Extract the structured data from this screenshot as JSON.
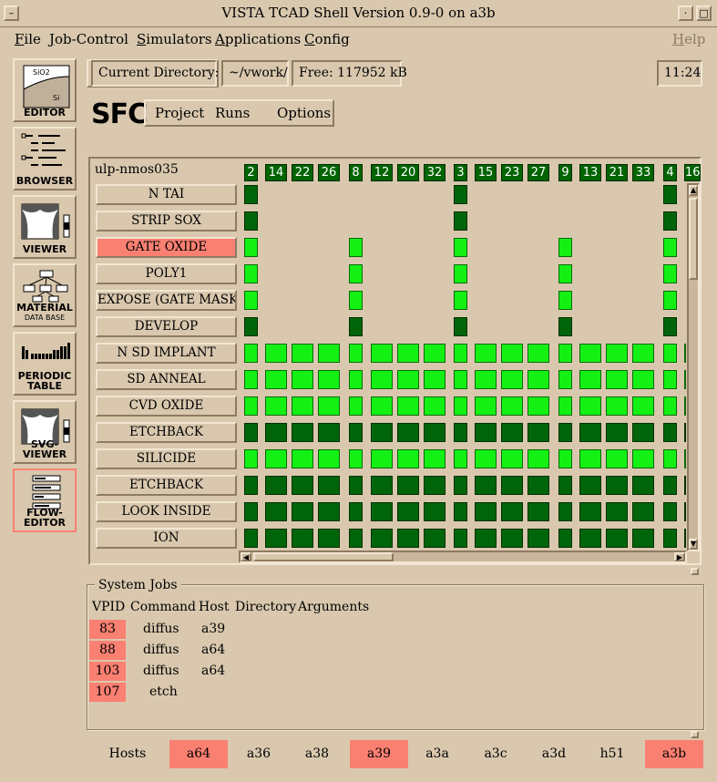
{
  "window": {
    "title": "VISTA TCAD Shell Version 0.9-0 on a3b"
  },
  "menubar": {
    "items": [
      {
        "label": "File",
        "u": "F",
        "rest": "ile"
      },
      {
        "label": "Job-Control",
        "u": "J",
        "rest": "ob-Control"
      },
      {
        "label": "Simulators",
        "u": "S",
        "rest": "imulators"
      },
      {
        "label": "Applications",
        "u": "A",
        "rest": "pplications"
      },
      {
        "label": "Config",
        "u": "C",
        "rest": "onfig"
      }
    ],
    "help": {
      "u": "H",
      "rest": "elp"
    }
  },
  "tools": [
    {
      "label": "EDITOR",
      "icon": "editor-icon"
    },
    {
      "label": "BROWSER",
      "icon": "browser-icon"
    },
    {
      "label": "VIEWER",
      "icon": "viewer-icon"
    },
    {
      "label": "MATERIAL",
      "sub": "DATA BASE",
      "icon": "material-icon"
    },
    {
      "label": "PERIODIC",
      "sub": "TABLE",
      "icon": "periodic-table-icon"
    },
    {
      "label": "SVG-VIEWER",
      "icon": "svg-viewer-icon"
    },
    {
      "label": "FLOW-EDITOR",
      "icon": "flow-editor-icon"
    }
  ],
  "editor_icon_text": {
    "sio2": "SiO2",
    "si": "Si"
  },
  "status": {
    "dir_label": "Current Directory:",
    "dir_value": "~/vwork/",
    "free": "Free: 117952 kB",
    "time": "11:24"
  },
  "sfc": {
    "logo": "SFC",
    "menu": [
      "Project",
      "Runs",
      "Options"
    ]
  },
  "flow": {
    "name": "ulp-nmos035",
    "columns": [
      "2",
      "14",
      "22",
      "26",
      "8",
      "12",
      "20",
      "32",
      "3",
      "15",
      "23",
      "27",
      "9",
      "13",
      "21",
      "33",
      "4",
      "16"
    ],
    "steps": [
      {
        "label": "N TAI",
        "selected": false
      },
      {
        "label": "STRIP SOX",
        "selected": false
      },
      {
        "label": "GATE OXIDE",
        "selected": true
      },
      {
        "label": "POLY1",
        "selected": false
      },
      {
        "label": "EXPOSE (GATE  MASK)",
        "selected": false
      },
      {
        "label": "DEVELOP",
        "selected": false
      },
      {
        "label": "N SD IMPLANT",
        "selected": false
      },
      {
        "label": "SD ANNEAL",
        "selected": false
      },
      {
        "label": "CVD OXIDE",
        "selected": false
      },
      {
        "label": "ETCHBACK",
        "selected": false
      },
      {
        "label": "SILICIDE",
        "selected": false
      },
      {
        "label": "ETCHBACK",
        "selected": false
      },
      {
        "label": "LOOK INSIDE",
        "selected": false
      },
      {
        "label": "ION",
        "selected": false
      }
    ],
    "grid": [
      "D.......D.......D.",
      "D.......D.......D.",
      "L...L...L...L...L.",
      "L...L...L...L...L.",
      "L...L...L...L...L.",
      "D...D...D...D...D.",
      "LLLLLLLLLLLLLLLLLL",
      "LLLLLLLLLLLLLLLLLL",
      "LLLLLLLLLLLLLLLLLL",
      "DDDDDDDDDDDDDDDDDD",
      "LLLLLLLLLLLLLLLLLL",
      "DDDDDDDDDDDDDDDDDD",
      "DDDDDDDDDDDDDDDDDD",
      "DDDDDDDDDDDDDDDDDD"
    ],
    "colors": {
      "dark": "#00640a",
      "light": "#14f014",
      "selected": "#fa8072"
    }
  },
  "jobs": {
    "title": "System Jobs",
    "headers": [
      "VPID",
      "Command",
      "Host",
      "Directory",
      "Arguments"
    ],
    "rows": [
      {
        "vpid": "83",
        "command": "diffus",
        "host": "a39"
      },
      {
        "vpid": "88",
        "command": "diffus",
        "host": "a64"
      },
      {
        "vpid": "103",
        "command": "diffus",
        "host": "a64"
      },
      {
        "vpid": "107",
        "command": "etch",
        "host": ""
      }
    ]
  },
  "hosts": {
    "label": "Hosts",
    "items": [
      {
        "name": "a64",
        "active": true
      },
      {
        "name": "a36",
        "active": false
      },
      {
        "name": "a38",
        "active": false
      },
      {
        "name": "a39",
        "active": true
      },
      {
        "name": "a3a",
        "active": false
      },
      {
        "name": "a3c",
        "active": false
      },
      {
        "name": "a3d",
        "active": false
      },
      {
        "name": "h51",
        "active": false
      },
      {
        "name": "a3b",
        "active": true
      }
    ]
  }
}
